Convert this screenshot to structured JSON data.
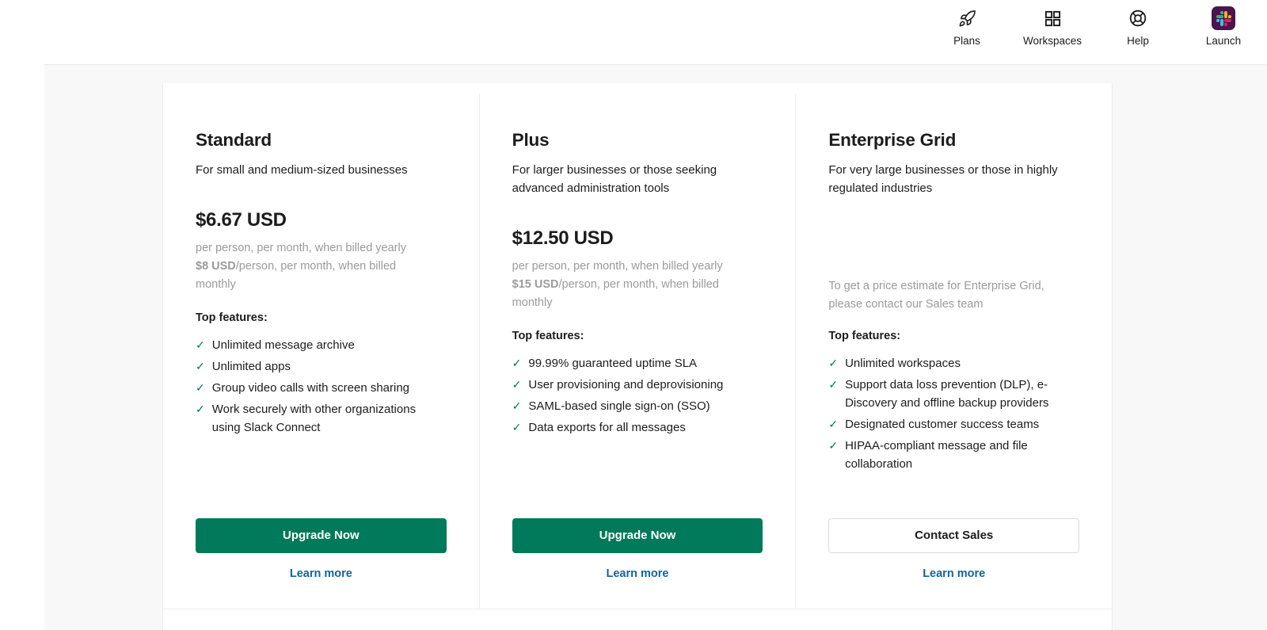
{
  "header": {
    "nav_items": [
      {
        "label": "Plans",
        "icon": "rocket-icon"
      },
      {
        "label": "Workspaces",
        "icon": "grid-icon"
      },
      {
        "label": "Help",
        "icon": "lifebuoy-icon"
      },
      {
        "label": "Launch",
        "icon": "slack-app-icon"
      }
    ]
  },
  "colors": {
    "accent_green": "#007a5a",
    "link_blue": "#1264a3",
    "brand_purple": "#4a154b",
    "muted_text": "#9b9b9b"
  },
  "plans": [
    {
      "name": "Standard",
      "tagline": "For small and medium-sized businesses",
      "price": "$6.67 USD",
      "price_note_line1": "per person, per month, when billed yearly",
      "price_note_strong": "$8 USD",
      "price_note_line2": "/person, per month, when billed monthly",
      "features_title": "Top features:",
      "features": [
        "Unlimited message archive",
        "Unlimited apps",
        "Group video calls with screen sharing",
        "Work securely with other organizations using Slack Connect"
      ],
      "cta_label": "Upgrade Now",
      "cta_style": "primary",
      "learn_more_label": "Learn more"
    },
    {
      "name": "Plus",
      "tagline": "For larger businesses or those seeking advanced administration tools",
      "price": "$12.50 USD",
      "price_note_line1": "per person, per month, when billed yearly",
      "price_note_strong": "$15 USD",
      "price_note_line2": "/person, per month, when billed monthly",
      "features_title": "Top features:",
      "features": [
        "99.99% guaranteed uptime SLA",
        "User provisioning and deprovisioning",
        "SAML-based single sign-on (SSO)",
        "Data exports for all messages"
      ],
      "cta_label": "Upgrade Now",
      "cta_style": "primary",
      "learn_more_label": "Learn more"
    },
    {
      "name": "Enterprise Grid",
      "tagline": "For very large businesses or those in highly regulated industries",
      "price": "",
      "estimate_note": "To get a price estimate for Enterprise Grid, please contact our Sales team",
      "features_title": "Top features:",
      "features": [
        "Unlimited workspaces",
        "Support data loss prevention (DLP), e-Discovery and offline backup providers",
        "Designated customer success teams",
        "HIPAA-compliant message and file collaboration"
      ],
      "cta_label": "Contact Sales",
      "cta_style": "secondary",
      "learn_more_label": "Learn more"
    }
  ]
}
